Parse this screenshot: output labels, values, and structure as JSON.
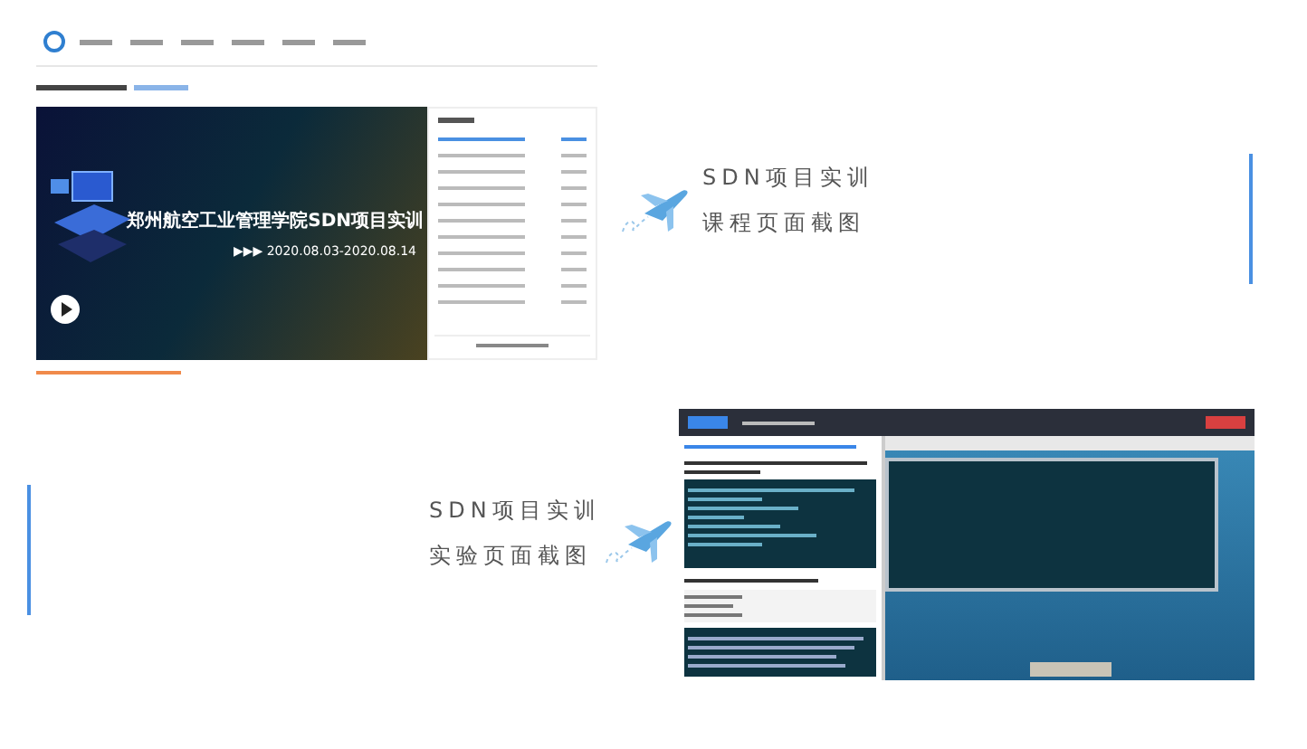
{
  "course_section": {
    "title": "SDN项目实训",
    "subtitle": "课程页面截图",
    "screenshot": {
      "banner_title": "郑州航空工业管理学院SDN项目实训",
      "banner_dates": "▶▶▶ 2020.08.03-2020.08.14",
      "playlist": [
        {
          "selected": true
        },
        {
          "selected": false
        },
        {
          "selected": false
        },
        {
          "selected": false
        },
        {
          "selected": false
        },
        {
          "selected": false
        },
        {
          "selected": false
        },
        {
          "selected": false
        },
        {
          "selected": false
        },
        {
          "selected": false
        },
        {
          "selected": false
        }
      ]
    }
  },
  "lab_section": {
    "title": "SDN项目实训",
    "subtitle": "实验页面截图"
  }
}
